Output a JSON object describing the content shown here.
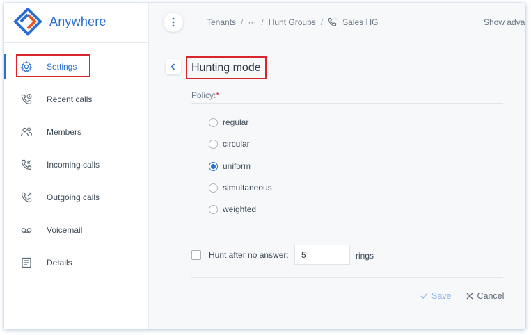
{
  "app": {
    "name": "Anywhere"
  },
  "sidebar": {
    "items": [
      {
        "label": "Settings",
        "icon": "gear-icon"
      },
      {
        "label": "Recent calls",
        "icon": "phone-clock-icon"
      },
      {
        "label": "Members",
        "icon": "members-icon"
      },
      {
        "label": "Incoming calls",
        "icon": "phone-incoming-icon"
      },
      {
        "label": "Outgoing calls",
        "icon": "phone-outgoing-icon"
      },
      {
        "label": "Voicemail",
        "icon": "voicemail-icon"
      },
      {
        "label": "Details",
        "icon": "details-icon"
      }
    ]
  },
  "breadcrumb": {
    "items": [
      "Tenants",
      "···",
      "Hunt Groups",
      "Sales HG"
    ],
    "separator": "/"
  },
  "topbar": {
    "show_advanced": "Show advan"
  },
  "form": {
    "title": "Hunting mode",
    "policy_label": "Policy:",
    "policy_required": "*",
    "policy_options": [
      "regular",
      "circular",
      "uniform",
      "simultaneous",
      "weighted"
    ],
    "policy_selected": "uniform",
    "hunt_label": "Hunt after no answer:",
    "hunt_checked": false,
    "rings_value": "5",
    "rings_label": "rings",
    "save_label": "Save",
    "cancel_label": "Cancel"
  },
  "colors": {
    "accent": "#2a6fd1",
    "highlight": "#d9262c",
    "save_disabled": "#8fb5e8"
  }
}
